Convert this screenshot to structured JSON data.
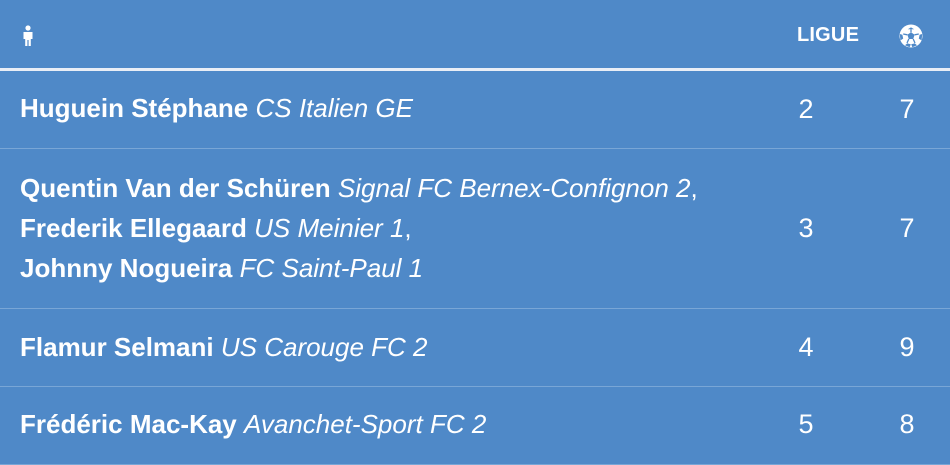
{
  "header": {
    "person_icon": "person-icon",
    "ligue_label": "LIGUE",
    "ball_icon": "soccer-ball-icon"
  },
  "rows": [
    {
      "players": [
        {
          "name": "Huguein Stéphane",
          "club": "CS Italien GE",
          "sep": ""
        }
      ],
      "ligue": "2",
      "goals": "7"
    },
    {
      "players": [
        {
          "name": "Quentin Van der Schüren",
          "club": "Signal FC Bernex-Confignon 2",
          "sep": ","
        },
        {
          "name": "Frederik Ellegaard",
          "club": "US Meinier 1",
          "sep": ","
        },
        {
          "name": "Johnny Nogueira",
          "club": "FC Saint-Paul 1",
          "sep": ""
        }
      ],
      "ligue": "3",
      "goals": "7"
    },
    {
      "players": [
        {
          "name": "Flamur Selmani",
          "club": "US Carouge FC 2",
          "sep": ""
        }
      ],
      "ligue": "4",
      "goals": "9"
    },
    {
      "players": [
        {
          "name": "Frédéric Mac-Kay",
          "club": "Avanchet-Sport FC 2",
          "sep": ""
        }
      ],
      "ligue": "5",
      "goals": "8"
    }
  ]
}
